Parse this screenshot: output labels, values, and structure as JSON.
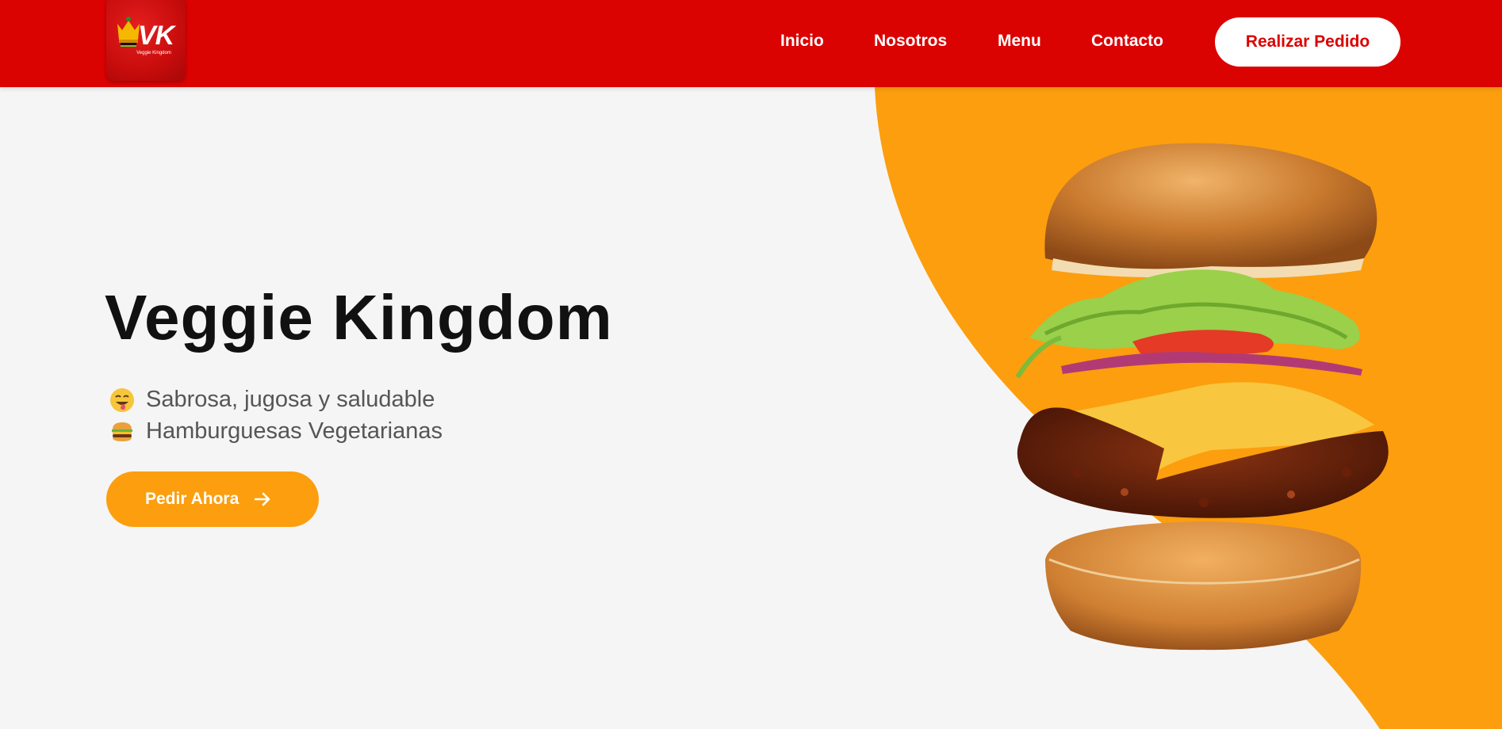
{
  "header": {
    "logo": {
      "letters": "VK",
      "subtitle": "Veggie Kingdom"
    },
    "nav": [
      {
        "label": "Inicio"
      },
      {
        "label": "Nosotros"
      },
      {
        "label": "Menu"
      },
      {
        "label": "Contacto"
      }
    ],
    "order_button": "Realizar Pedido"
  },
  "hero": {
    "title": "Veggie Kingdom",
    "taglines": [
      {
        "emoji": "tongue-out-face-icon",
        "text": "Sabrosa, jugosa y saludable"
      },
      {
        "emoji": "hamburger-icon",
        "text": "Hamburguesas Vegetarianas"
      }
    ],
    "cta_label": "Pedir Ahora",
    "image": "veggie-burger-exploded"
  },
  "colors": {
    "header_red": "#db0202",
    "accent_orange": "#fc9e0e",
    "background": "#f5f5f5",
    "title": "#111111",
    "tagline": "#555555"
  }
}
